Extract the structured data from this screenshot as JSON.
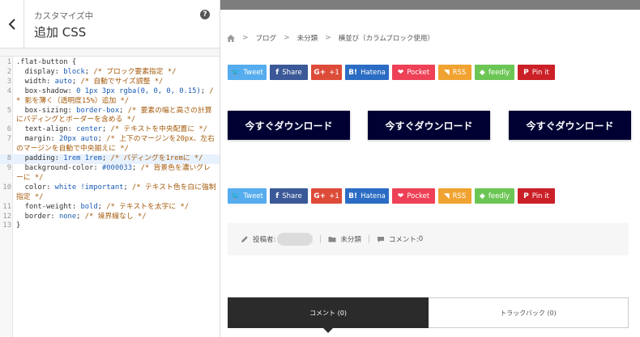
{
  "sidebar": {
    "subtitle": "カスタマイズ中",
    "title": "追加 CSS",
    "help_glyph": "?"
  },
  "editor": {
    "lines": [
      {
        "num": "1",
        "tokens": [
          {
            "t": ".flat-button {",
            "k": "p"
          }
        ]
      },
      {
        "num": "2",
        "tokens": [
          {
            "t": "  display: ",
            "k": "p"
          },
          {
            "t": "block",
            "k": "v"
          },
          {
            "t": "; ",
            "k": "p"
          },
          {
            "t": "/* ブロック要素指定 */",
            "k": "c"
          }
        ]
      },
      {
        "num": "3",
        "tokens": [
          {
            "t": "  width: ",
            "k": "p"
          },
          {
            "t": "auto",
            "k": "v"
          },
          {
            "t": "; ",
            "k": "p"
          },
          {
            "t": "/* 自動でサイズ調整 */",
            "k": "c"
          }
        ]
      },
      {
        "num": "4",
        "tokens": [
          {
            "t": "  box-shadow: ",
            "k": "p"
          },
          {
            "t": "0 1px 3px rgba(0, 0, 0, 0.15)",
            "k": "v"
          },
          {
            "t": "; ",
            "k": "p"
          },
          {
            "t": "/* 影を薄く（透明度15%）追加 */",
            "k": "c"
          }
        ]
      },
      {
        "num": "5",
        "tokens": [
          {
            "t": "  box-sizing: ",
            "k": "p"
          },
          {
            "t": "border-box",
            "k": "v"
          },
          {
            "t": "; ",
            "k": "p"
          },
          {
            "t": "/* 要素の幅と高さの計算にパディングとボーダーを含める */",
            "k": "c"
          }
        ]
      },
      {
        "num": "6",
        "tokens": [
          {
            "t": "  text-align: ",
            "k": "p"
          },
          {
            "t": "center",
            "k": "v"
          },
          {
            "t": "; ",
            "k": "p"
          },
          {
            "t": "/* テキストを中央配置に */",
            "k": "c"
          }
        ]
      },
      {
        "num": "7",
        "tokens": [
          {
            "t": "  margin: ",
            "k": "p"
          },
          {
            "t": "20px auto",
            "k": "v"
          },
          {
            "t": "; ",
            "k": "p"
          },
          {
            "t": "/* 上下のマージンを20px、左右のマージンを自動で中央揃えに */",
            "k": "c"
          }
        ]
      },
      {
        "num": "8",
        "tokens": [
          {
            "t": "  padding: ",
            "k": "p"
          },
          {
            "t": "1rem 1rem",
            "k": "v"
          },
          {
            "t": "; ",
            "k": "p"
          },
          {
            "t": "/* パディングを1remに */",
            "k": "c"
          }
        ],
        "active": true
      },
      {
        "num": "9",
        "tokens": [
          {
            "t": "  background-color: ",
            "k": "p"
          },
          {
            "t": "#000033",
            "k": "v"
          },
          {
            "t": "; ",
            "k": "p"
          },
          {
            "t": "/* 背景色を濃いグレーに */",
            "k": "c"
          }
        ]
      },
      {
        "num": "10",
        "tokens": [
          {
            "t": "  color: ",
            "k": "p"
          },
          {
            "t": "white !important",
            "k": "v"
          },
          {
            "t": "; ",
            "k": "p"
          },
          {
            "t": "/* テキスト色を白に強制指定 */",
            "k": "c"
          }
        ]
      },
      {
        "num": "11",
        "tokens": [
          {
            "t": "  font-weight: ",
            "k": "p"
          },
          {
            "t": "bold",
            "k": "v"
          },
          {
            "t": "; ",
            "k": "p"
          },
          {
            "t": "/* テキストを太字に */",
            "k": "c"
          }
        ]
      },
      {
        "num": "12",
        "tokens": [
          {
            "t": "  border: ",
            "k": "p"
          },
          {
            "t": "none",
            "k": "v"
          },
          {
            "t": "; ",
            "k": "p"
          },
          {
            "t": "/* 境界線なし */",
            "k": "c"
          }
        ]
      },
      {
        "num": "13",
        "tokens": [
          {
            "t": "}",
            "k": "p"
          }
        ]
      }
    ]
  },
  "breadcrumb": {
    "items": [
      "ブログ",
      "未分類",
      "横並び（カラムブロック使用）"
    ],
    "separator": ">"
  },
  "share": {
    "twitter": {
      "icon": "🐦",
      "label": "Tweet"
    },
    "facebook": {
      "icon": "f",
      "label": "Share"
    },
    "google": {
      "icon": "G+",
      "label": "+1"
    },
    "hatena": {
      "icon": "B!",
      "label": "Hatena"
    },
    "pocket": {
      "icon": "❤",
      "label": "Pocket"
    },
    "rss": {
      "icon": "◥",
      "label": "RSS"
    },
    "feedly": {
      "icon": "◆",
      "label": "feedly"
    },
    "pinterest": {
      "icon": "P",
      "label": "Pin it"
    }
  },
  "download_buttons": [
    "今すぐダウンロード",
    "今すぐダウンロード",
    "今すぐダウンロード"
  ],
  "meta": {
    "author_label": "投稿者:",
    "category": "未分類",
    "comment_label": "コメント:",
    "comment_count": "0"
  },
  "tabs": {
    "comments": "コメント (0)",
    "trackbacks": "トラックバック (0)"
  },
  "colors": {
    "button_bg": "#000033",
    "twitter": "#55acee",
    "facebook": "#3b5998",
    "google": "#dd4b39",
    "hatena": "#2b6cc4",
    "pocket": "#ee4056",
    "rss": "#f0a330",
    "feedly": "#6cc655",
    "pinterest": "#cb2027"
  }
}
